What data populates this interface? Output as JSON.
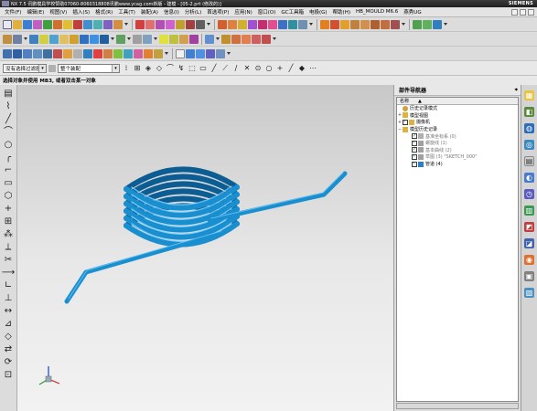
{
  "window": {
    "title": "NX 7.5 讯鹏模具学校赞助07060-8060318808讯鹏www.ycag.com新版 - 建模 - [05-2.prt (修改的)]",
    "brand": "SIEMENS"
  },
  "menubar": {
    "items": [
      "文件(F)",
      "编辑(E)",
      "视图(V)",
      "插入(S)",
      "格式(R)",
      "工具(T)",
      "装配(A)",
      "信息(I)",
      "分析(L)",
      "首选项(P)",
      "应用(N)",
      "窗口(O)",
      "GC工具箱",
      "电极(G)",
      "帮助(H)",
      "HB_MOULD M6.6",
      "燕秀UG"
    ]
  },
  "selection_bar": {
    "filter_value": "没有选择过滤器",
    "scope_value": "整个装配"
  },
  "status": {
    "message": "选择对象并使用 MB3, 或者双击某一对象"
  },
  "navigator": {
    "title": "部件导航器",
    "column_name": "名称",
    "items": [
      {
        "label": "历史记录模式",
        "type": "mode",
        "dim": false
      },
      {
        "label": "模型视图",
        "type": "folder",
        "dim": false
      },
      {
        "label": "摄像机",
        "type": "folder",
        "dim": false
      },
      {
        "label": "模型历史记录",
        "type": "folder",
        "dim": false
      },
      {
        "label": "基准坐标系 (0)",
        "type": "feature",
        "dim": true
      },
      {
        "label": "螺旋线 (1)",
        "type": "feature",
        "dim": true
      },
      {
        "label": "基本曲线 (2)",
        "type": "feature",
        "dim": true
      },
      {
        "label": "草图 (3) \"SKETCH_000\"",
        "type": "feature",
        "dim": true
      },
      {
        "label": "管道 (4)",
        "type": "feature",
        "dim": false
      }
    ]
  },
  "colors": {
    "model_blue": "#1a8fd0",
    "viewport_top": "#c8c8c8",
    "viewport_bottom": "#f2f2f2"
  }
}
